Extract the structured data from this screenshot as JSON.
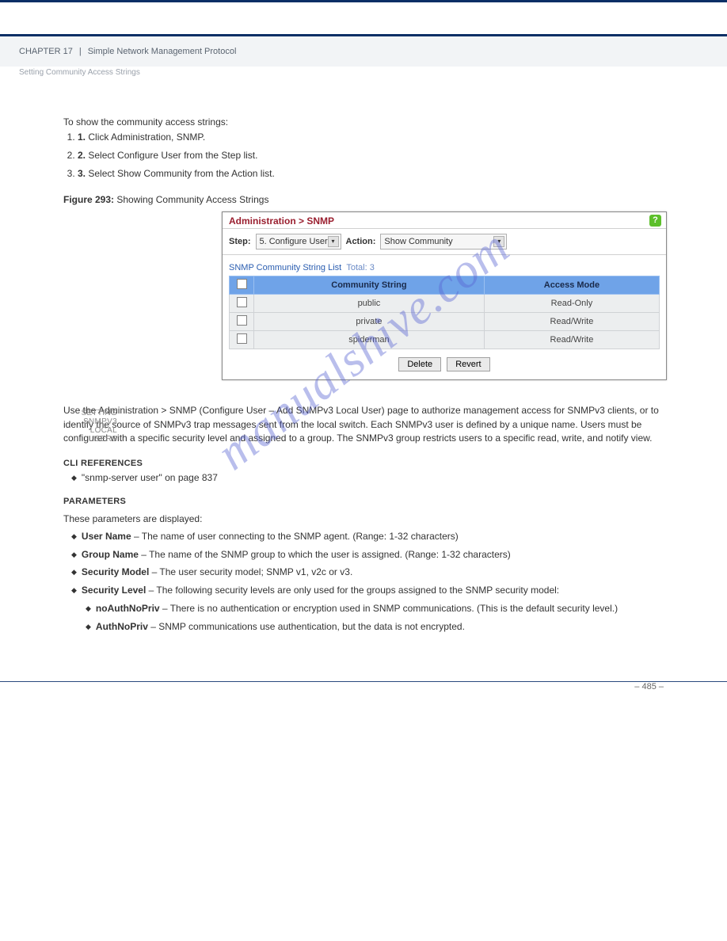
{
  "header": {
    "chapter_label": "CHAPTER 17",
    "separator": "|",
    "chapter_title": "Simple Network Management Protocol",
    "subtitle": "Setting Community Access Strings",
    "chapter_num": "17"
  },
  "intro": {
    "show_heading": "To show the community access strings:",
    "steps": [
      "Click Administration, SNMP.",
      "Select Configure User from the Step list.",
      "Select Show Community from the Action list."
    ],
    "figcap_label": "Figure 293:",
    "figcap_text": " Showing Community Access Strings"
  },
  "panel": {
    "title": "Administration > SNMP",
    "step_label": "Step:",
    "step_value": "5. Configure User",
    "action_label": "Action:",
    "action_value": "Show Community",
    "list_title": "SNMP Community String List",
    "total_label": "Total: 3",
    "col_community": "Community String",
    "col_access": "Access Mode",
    "rows": [
      {
        "community": "public",
        "access": "Read-Only"
      },
      {
        "community": "private",
        "access": "Read/Write"
      },
      {
        "community": "spiderman",
        "access": "Read/Write"
      }
    ],
    "btn_delete": "Delete",
    "btn_revert": "Revert"
  },
  "section": {
    "gutter_label": "SETTING SNMPV3 LOCAL USERS",
    "heading": "Setting SNMPv3 Local Users",
    "intro": "Use the Administration > SNMP (Configure User – Add SNMPv3 Local User) page to authorize management access for SNMPv3 clients, or to identify the source of SNMPv3 trap messages sent from the local switch. Each SNMPv3 user is defined by a unique name. Users must be configured with a specific security level and assigned to a group. The SNMPv3 group restricts users to a specific read, write, and notify view.",
    "cli_ref_label": "CLI REFERENCES",
    "cli_ref_item": "\"snmp-server user\" on page 837",
    "params_label": "PARAMETERS",
    "params_lead": "These parameters are displayed:",
    "params": [
      {
        "name": "User Name",
        "desc": " – The name of user connecting to the SNMP agent. (Range: 1-32 characters)"
      },
      {
        "name": "Group Name",
        "desc": " – The name of the SNMP group to which the user is assigned. (Range: 1-32 characters)"
      },
      {
        "name": "Security Model",
        "desc": " – The user security model; SNMP v1, v2c or v3."
      },
      {
        "name": "Security Level",
        "desc": " – The following security levels are only used for the groups assigned to the SNMP security model:"
      }
    ],
    "sub_params": [
      {
        "name": "noAuthNoPriv",
        "desc": " – There is no authentication or encryption used in SNMP communications. (This is the default security level.)"
      },
      {
        "name": "AuthNoPriv",
        "desc": " – SNMP communications use authentication, but the data is not encrypted."
      }
    ]
  },
  "footer": {
    "pagenum": "– 485 –"
  },
  "watermark": "manualshive.com"
}
